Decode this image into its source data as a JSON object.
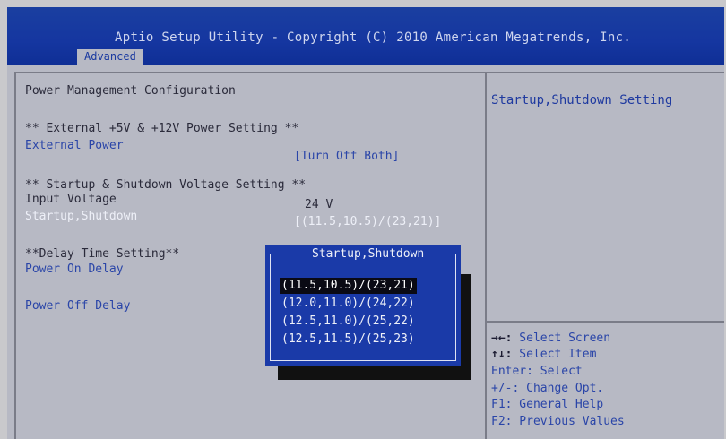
{
  "header": {
    "title": "Aptio Setup Utility - Copyright (C) 2010 American Megatrends, Inc.",
    "active_tab": "Advanced"
  },
  "main": {
    "page_title": "Power Management Configuration",
    "section1": "** External +5V & +12V Power Setting **",
    "external_power": {
      "label": "External Power",
      "value": "[Turn Off Both]"
    },
    "section2": "** Startup & Shutdown Voltage Setting **",
    "input_voltage": {
      "label": "Input Voltage",
      "value": "24 V"
    },
    "startup_shutdown": {
      "label": "Startup,Shutdown",
      "value": "[(11.5,10.5)/(23,21)]"
    },
    "section3": "**Delay Time Setting**",
    "power_on_delay": {
      "label": "Power On Delay"
    },
    "power_off_delay": {
      "label": "Power Off Delay"
    }
  },
  "popup": {
    "title": "Startup,Shutdown",
    "options": [
      "(11.5,10.5)/(23,21)",
      "(12.0,11.0)/(24,22)",
      "(12.5,11.0)/(25,22)",
      "(12.5,11.5)/(25,23)"
    ],
    "selected_index": 0
  },
  "help": {
    "text": "Startup,Shutdown Setting",
    "keys": [
      {
        "key": "→←:",
        "desc": " Select Screen"
      },
      {
        "key": "↑↓:",
        "desc": " Select Item"
      },
      {
        "key": "",
        "desc": "Enter: Select"
      },
      {
        "key": "",
        "desc": "+/-: Change Opt."
      },
      {
        "key": "",
        "desc": "F1: General Help"
      },
      {
        "key": "",
        "desc": "F2: Previous Values"
      }
    ]
  },
  "colors": {
    "header_blue": "#1536a0",
    "panel_gray": "#b7b9c4",
    "popup_blue": "#1a3aa8",
    "highlight_white": "#eef0f8"
  }
}
